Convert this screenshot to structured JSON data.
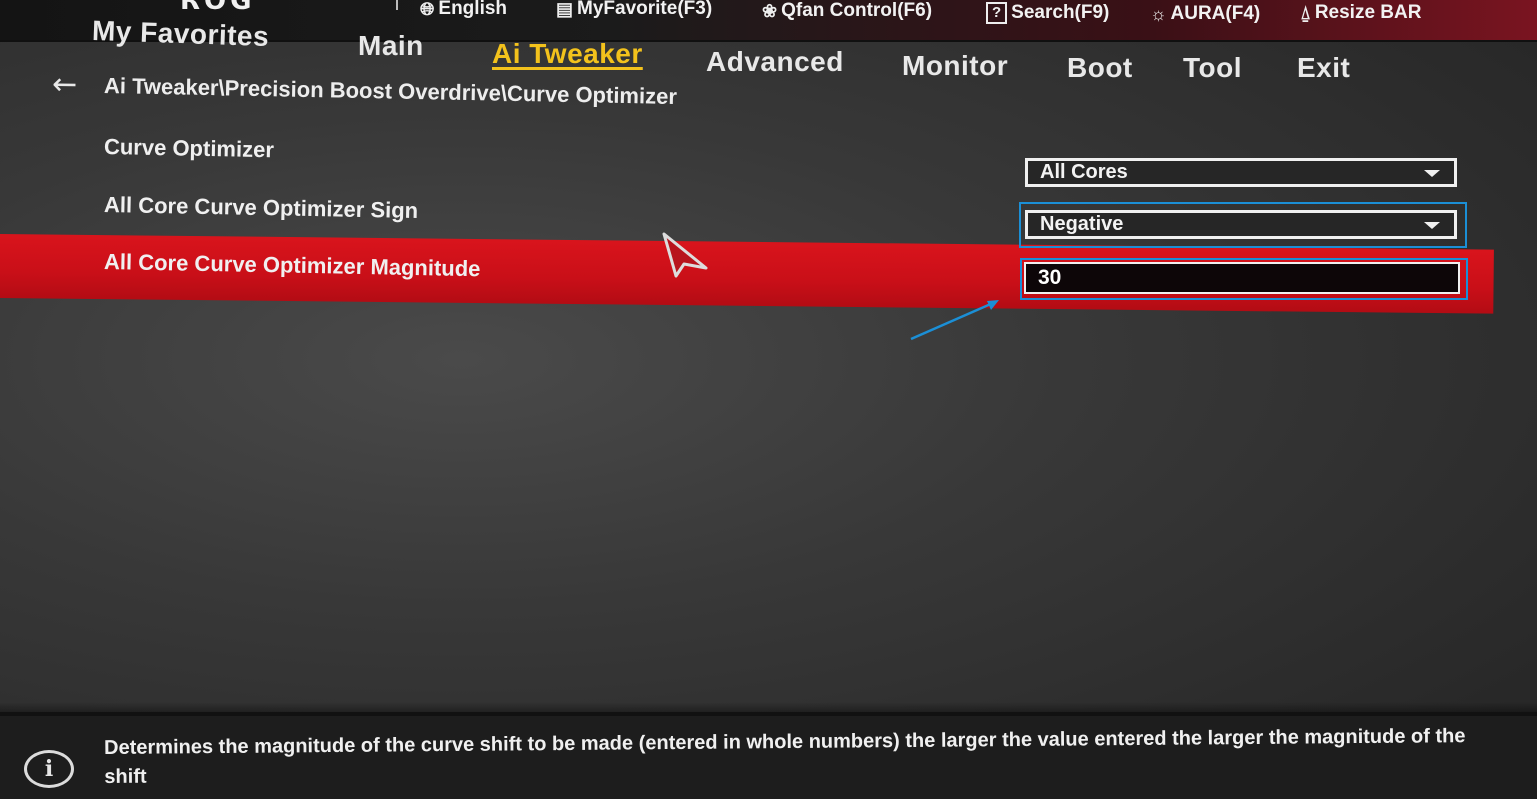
{
  "header": {
    "brand_fragment": "ROG",
    "hotkeys": [
      {
        "label": "English",
        "icon": "globe-icon"
      },
      {
        "label": "MyFavorite(F3)",
        "icon": "favorite-list-icon"
      },
      {
        "label": "Qfan Control(F6)",
        "icon": "fan-icon"
      },
      {
        "label": "Search(F9)",
        "icon": "help-search-icon"
      },
      {
        "label": "AURA(F4)",
        "icon": "aura-light-icon"
      },
      {
        "label": "Resize BAR",
        "icon": "resize-bar-icon"
      }
    ]
  },
  "tabs": [
    {
      "label": "My Favorites"
    },
    {
      "label": "Main"
    },
    {
      "label": "Ai Tweaker",
      "active": true
    },
    {
      "label": "Advanced"
    },
    {
      "label": "Monitor"
    },
    {
      "label": "Boot"
    },
    {
      "label": "Tool"
    },
    {
      "label": "Exit"
    }
  ],
  "breadcrumb": {
    "path": "Ai Tweaker\\Precision Boost Overdrive\\Curve Optimizer"
  },
  "settings": [
    {
      "label": "Curve Optimizer",
      "value": "All Cores",
      "control": "dropdown"
    },
    {
      "label": "All Core Curve Optimizer Sign",
      "value": "Negative",
      "control": "dropdown"
    },
    {
      "label": "All Core Curve Optimizer Magnitude",
      "value": "30",
      "control": "input",
      "selected": true
    }
  ],
  "help": {
    "text": "Determines the magnitude of the curve shift to be made (entered in whole numbers) the larger the value entered the larger the magnitude of the shift"
  },
  "colors": {
    "accent_red": "#d9141c",
    "active_tab_yellow": "#f3c21c",
    "annotation_blue": "#1b8fd6"
  }
}
